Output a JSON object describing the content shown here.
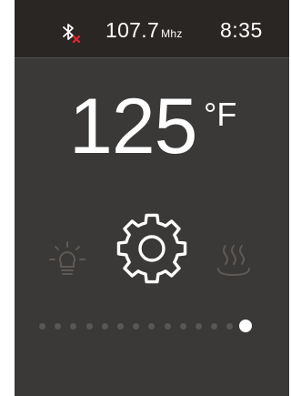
{
  "status_bar": {
    "bluetooth_icon": "bluetooth-disconnected-icon",
    "frequency_value": "107.7",
    "frequency_unit": "Mhz",
    "time": "8:35"
  },
  "main": {
    "temperature_value": "125",
    "temperature_unit": "°F"
  },
  "icons": {
    "left": "light-bulb-icon",
    "center": "gear-icon",
    "right": "steam-icon"
  },
  "colors": {
    "background": "#3a3938",
    "status_bar": "#2a2624",
    "icon_dim": "#5e5955",
    "bluetooth_off_mark": "#e3262b"
  },
  "pager": {
    "total": 14,
    "active": 14
  }
}
